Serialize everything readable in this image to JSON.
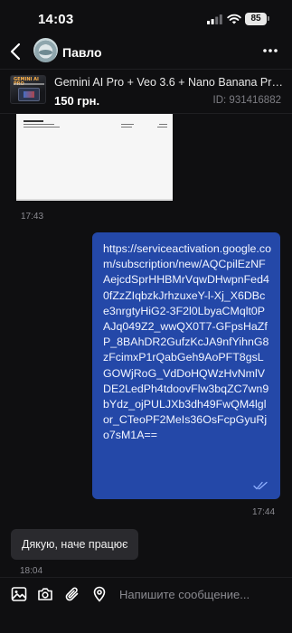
{
  "status": {
    "time": "14:03",
    "battery": "85"
  },
  "header": {
    "contact_name": "Павло"
  },
  "listing": {
    "title": "Gemini AI Pro + Veo 3.6 + Nano Banana Pro +...",
    "price": "150 грн.",
    "id": "ID: 931416882",
    "thumb_title": "GEMINI AI PRO"
  },
  "messages": [
    {
      "type": "image",
      "time": "17:43"
    },
    {
      "type": "outgoing",
      "text": "https://serviceactivation.google.com/subscription/new/AQCpilEzNFAejcdSprHHBMrVqwDHwpnFed40fZzZIqbzkJrhzuxeY-l-Xj_X6DBce3nrgtyHiG2-3F2l0LbyaCMqlt0PAJq049Z2_wwQX0T7-GFpsHaZfP_8BAhDR2GufzKcJA9nfYihnG8zFcimxP1rQabGeh9AoPFT8gsLGOWjRoG_VdDoHQWzHvNmlVDE2LedPh4tdoovFlw3bqZC7wn9bYdz_ojPULJXb3dh49FwQM4lglor_CTeoPF2MeIs36OsFcpGyuRjo7sM1A==",
      "time": "17:44"
    },
    {
      "type": "incoming",
      "text": "Дякую, наче працює",
      "time": "18:04"
    }
  ],
  "input": {
    "placeholder": "Напишите сообщение..."
  },
  "colors": {
    "background": "#0f0f11",
    "outgoing_bubble": "#2448a8",
    "incoming_bubble": "#2a2a2e"
  }
}
